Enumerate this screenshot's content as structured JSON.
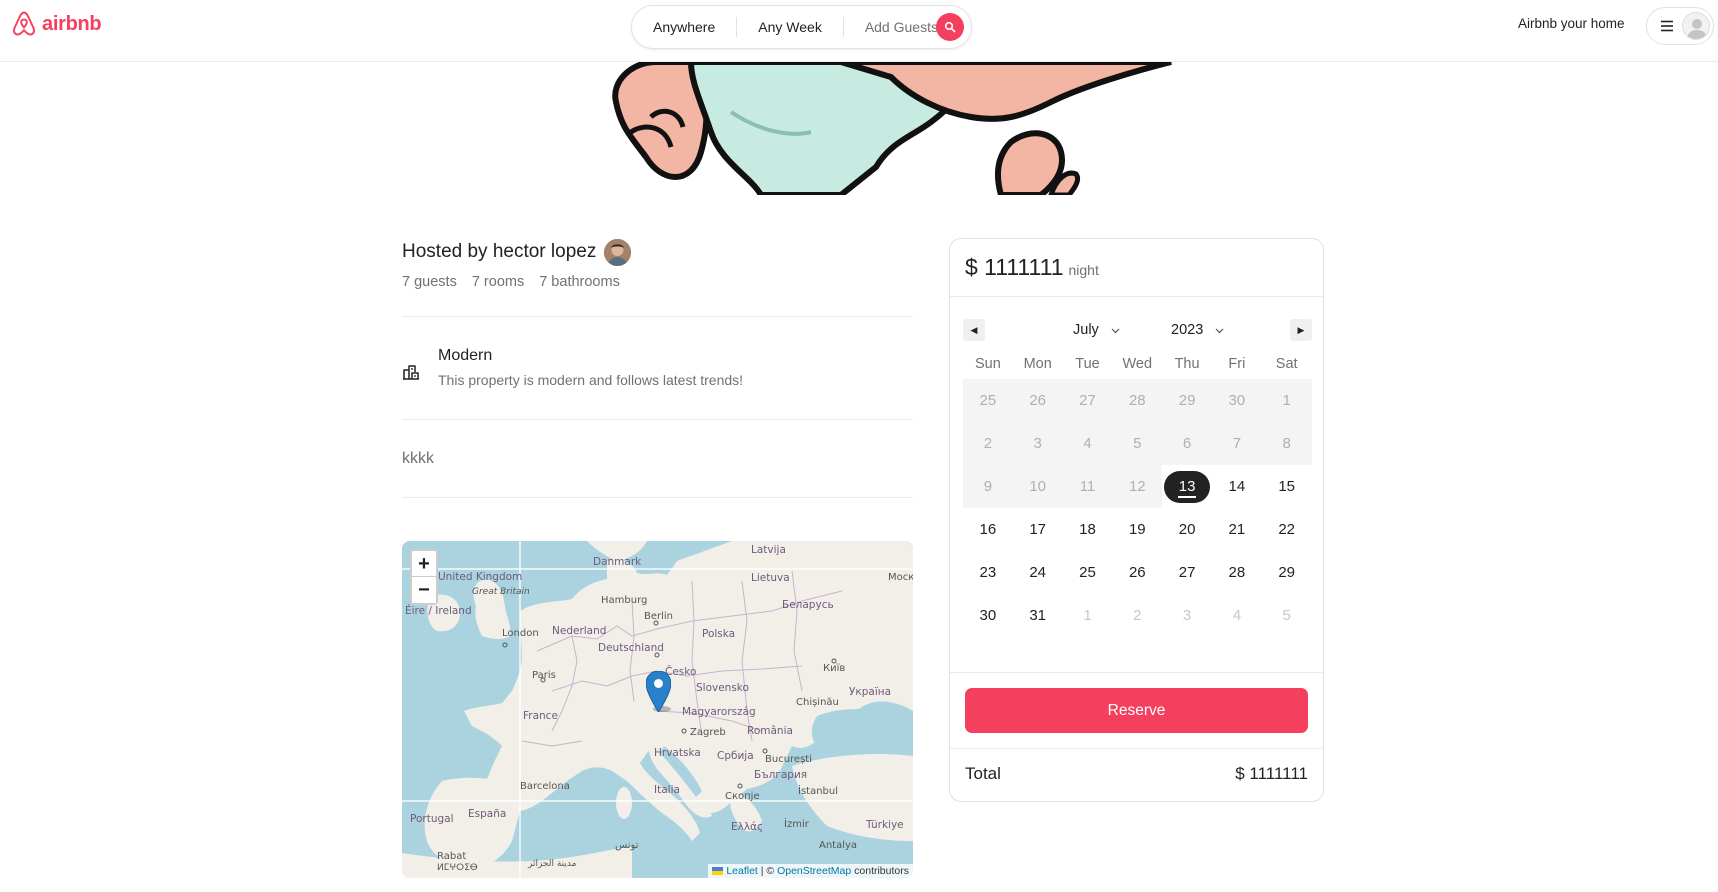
{
  "navbar": {
    "logo_text": "airbnb",
    "search": {
      "anywhere": "Anywhere",
      "any_week": "Any Week",
      "add_guests": "Add Guests"
    },
    "host_link": "Airbnb your home"
  },
  "listing": {
    "host_title": "Hosted by hector lopez",
    "stats": {
      "guests": "7 guests",
      "rooms": "7 rooms",
      "bathrooms": "7 bathrooms"
    },
    "category": {
      "label": "Modern",
      "description": "This property is modern and follows latest trends!"
    },
    "description": "kkkk"
  },
  "map": {
    "zoom_in": "+",
    "zoom_out": "−",
    "attribution": {
      "leaflet": "Leaflet",
      "separator": " | © ",
      "osm": "OpenStreetMap",
      "suffix": " contributors"
    },
    "labels": {
      "danmark": "Danmark",
      "latvija": "Latvija",
      "mock": "Моск",
      "united_kingdom": "United Kingdom",
      "great_britain": "Great Britain",
      "lietuva": "Lietuva",
      "hamburg": "Hamburg",
      "eire": "Éire / Ireland",
      "berlin": "Berlin",
      "belarus": "Беларусь",
      "london": "London",
      "nederland": "Nederland",
      "polska": "Polska",
      "deutschland": "Deutschland",
      "cesko": "Česko",
      "kyiv": "Київ",
      "paris": "Paris",
      "slovensko": "Slovensko",
      "ukraina": "Україна",
      "chisinau": "Chișinău",
      "france": "France",
      "magyarorszag": "Magyarország",
      "zagreb": "Zagreb",
      "romania": "România",
      "hrvatska": "Hrvatska",
      "srbija": "Србија",
      "bucuresti": "București",
      "balgariya": "България",
      "barcelona": "Barcelona",
      "italia": "Italia",
      "skopje": "Скопје",
      "istanbul": "İstanbul",
      "portugal": "Portugal",
      "espana": "España",
      "ellas": "Ελλάς",
      "izmir": "İzmir",
      "turkiye": "Türkiye",
      "tunis": "تونس",
      "rabat": "Rabat",
      "maghrib": "ⵍⵎⵖⵔⵉⴱ",
      "jazair": "مدينة الجزائر",
      "antalya": "Antalya"
    }
  },
  "booking": {
    "price": "$ 1111111",
    "per": "night",
    "calendar": {
      "prev": "◀",
      "next": "▶",
      "month": "July",
      "year": "2023",
      "weekdays": [
        "Sun",
        "Mon",
        "Tue",
        "Wed",
        "Thu",
        "Fri",
        "Sat"
      ],
      "weeks": [
        [
          "25",
          "26",
          "27",
          "28",
          "29",
          "30",
          "1"
        ],
        [
          "2",
          "3",
          "4",
          "5",
          "6",
          "7",
          "8"
        ],
        [
          "9",
          "10",
          "11",
          "12",
          "13",
          "14",
          "15"
        ],
        [
          "16",
          "17",
          "18",
          "19",
          "20",
          "21",
          "22"
        ],
        [
          "23",
          "24",
          "25",
          "26",
          "27",
          "28",
          "29"
        ],
        [
          "30",
          "31",
          "1",
          "2",
          "3",
          "4",
          "5"
        ]
      ],
      "selected": "13"
    },
    "reserve_label": "Reserve",
    "total_label": "Total",
    "total_value": "$ 1111111"
  },
  "colors": {
    "brand": "#F43F5E",
    "text": "#222222",
    "muted": "#717171"
  }
}
